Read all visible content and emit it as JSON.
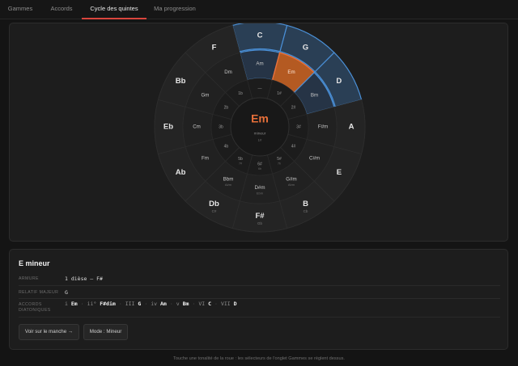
{
  "tabs": [
    {
      "label": "Gammes",
      "active": false
    },
    {
      "label": "Accords",
      "active": false
    },
    {
      "label": "Cycle des quintes",
      "active": true
    },
    {
      "label": "Ma progression",
      "active": false
    }
  ],
  "wheel": {
    "center": {
      "key": "Em",
      "mode": "mineur",
      "signature": "1#"
    },
    "major_keys": [
      "C",
      "G",
      "D",
      "A",
      "E",
      "B",
      "F#",
      "Db",
      "Ab",
      "Eb",
      "Bb",
      "F"
    ],
    "minor_keys": [
      {
        "name": "Am",
        "enh": ""
      },
      {
        "name": "Em",
        "enh": ""
      },
      {
        "name": "Bm",
        "enh": ""
      },
      {
        "name": "F#m",
        "enh": ""
      },
      {
        "name": "C#m",
        "enh": ""
      },
      {
        "name": "G#m",
        "enh": "Abm"
      },
      {
        "name": "D#m",
        "enh": "Ebm"
      },
      {
        "name": "Bbm",
        "enh": "A#m"
      },
      {
        "name": "Fm",
        "enh": ""
      },
      {
        "name": "Cm",
        "enh": ""
      },
      {
        "name": "Gm",
        "enh": ""
      },
      {
        "name": "Dm",
        "enh": ""
      }
    ],
    "major_enh": {
      "B": "Cb",
      "F#": "Gb",
      "Db": "C#"
    },
    "signatures": [
      {
        "main": "—",
        "sub": ""
      },
      {
        "main": "1#",
        "sub": ""
      },
      {
        "main": "2#",
        "sub": ""
      },
      {
        "main": "3#",
        "sub": ""
      },
      {
        "main": "4#",
        "sub": ""
      },
      {
        "main": "5#",
        "sub": "7b"
      },
      {
        "main": "6#",
        "sub": "6b"
      },
      {
        "main": "5b",
        "sub": "7#"
      },
      {
        "main": "4b",
        "sub": ""
      },
      {
        "main": "3b",
        "sub": ""
      },
      {
        "main": "2b",
        "sub": ""
      },
      {
        "main": "1b",
        "sub": ""
      }
    ],
    "highlight_major": [
      "C",
      "G",
      "D"
    ],
    "highlight_minor": [
      "Am",
      "Em",
      "Bm"
    ],
    "selected": "Em",
    "colors": {
      "accent": "#e8703a",
      "highlight": "#4a8fd6",
      "selected_fill": "#b45a22"
    }
  },
  "info": {
    "title": "E mineur",
    "rows": {
      "armure": {
        "label": "ARMURE",
        "value": "1 dièse — F#"
      },
      "relatif": {
        "label": "RELATIF MAJEUR",
        "value": "G"
      },
      "accords": {
        "label1": "ACCORDS",
        "label2": "DIATONIQUES",
        "chords": [
          {
            "degree": "i",
            "chord": "Em"
          },
          {
            "degree": "ii°",
            "chord": "F#dim"
          },
          {
            "degree": "III",
            "chord": "G"
          },
          {
            "degree": "iv",
            "chord": "Am"
          },
          {
            "degree": "v",
            "chord": "Bm"
          },
          {
            "degree": "VI",
            "chord": "C"
          },
          {
            "degree": "VII",
            "chord": "D"
          }
        ]
      }
    },
    "buttons": {
      "manche": "Voir sur le manche →",
      "mode": "Mode : Mineur"
    }
  },
  "hint": "Touche une tonalité de la roue : les sélecteurs de l'onglet Gammes se règlent dessus."
}
